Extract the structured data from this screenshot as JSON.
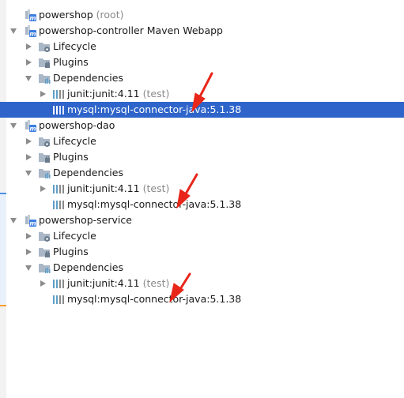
{
  "colors": {
    "selection": "#2f65ca",
    "annotation_arrow": "#e8261a",
    "folder": "#a9b7c6",
    "maven_badge": "#3d7ee0",
    "library_bars": "#5f9ec9"
  },
  "tree": {
    "root": {
      "name": "powershop",
      "suffix": "(root)"
    },
    "modules": [
      {
        "name": "powershop-controller Maven Webapp",
        "lifecycle": "Lifecycle",
        "plugins": "Plugins",
        "dependencies": "Dependencies",
        "deps": [
          {
            "name": "junit:junit:4.11",
            "scope": "(test)"
          },
          {
            "name": "mysql:mysql-connector-java:5.1.38",
            "scope": ""
          }
        ]
      },
      {
        "name": "powershop-dao",
        "lifecycle": "Lifecycle",
        "plugins": "Plugins",
        "dependencies": "Dependencies",
        "deps": [
          {
            "name": "junit:junit:4.11",
            "scope": "(test)"
          },
          {
            "name": "mysql:mysql-connector-java:5.1.38",
            "scope": ""
          }
        ]
      },
      {
        "name": "powershop-service",
        "lifecycle": "Lifecycle",
        "plugins": "Plugins",
        "dependencies": "Dependencies",
        "deps": [
          {
            "name": "junit:junit:4.11",
            "scope": "(test)"
          },
          {
            "name": "mysql:mysql-connector-java:5.1.38",
            "scope": ""
          }
        ]
      }
    ]
  }
}
